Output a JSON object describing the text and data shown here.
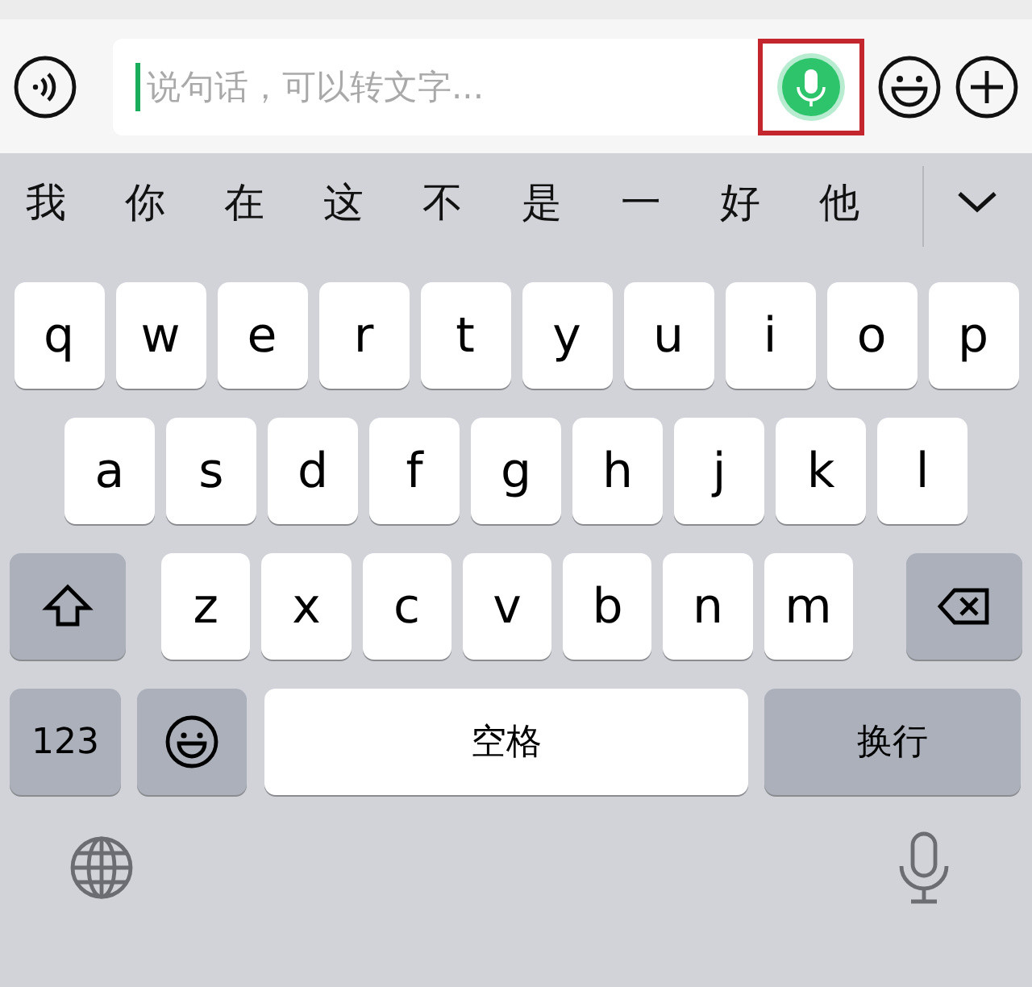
{
  "input_bar": {
    "placeholder": "说句话，可以转文字...",
    "voice_to_text": {
      "highlighted": true
    }
  },
  "candidates": [
    "我",
    "你",
    "在",
    "这",
    "不",
    "是",
    "一",
    "好",
    "他"
  ],
  "keyboard": {
    "rows": [
      {
        "keys": [
          {
            "kind": "letter",
            "label": "q"
          },
          {
            "kind": "letter",
            "label": "w"
          },
          {
            "kind": "letter",
            "label": "e"
          },
          {
            "kind": "letter",
            "label": "r"
          },
          {
            "kind": "letter",
            "label": "t"
          },
          {
            "kind": "letter",
            "label": "y"
          },
          {
            "kind": "letter",
            "label": "u"
          },
          {
            "kind": "letter",
            "label": "i"
          },
          {
            "kind": "letter",
            "label": "o"
          },
          {
            "kind": "letter",
            "label": "p"
          }
        ]
      },
      {
        "keys": [
          {
            "kind": "letter",
            "label": "a"
          },
          {
            "kind": "letter",
            "label": "s"
          },
          {
            "kind": "letter",
            "label": "d"
          },
          {
            "kind": "letter",
            "label": "f"
          },
          {
            "kind": "letter",
            "label": "g"
          },
          {
            "kind": "letter",
            "label": "h"
          },
          {
            "kind": "letter",
            "label": "j"
          },
          {
            "kind": "letter",
            "label": "k"
          },
          {
            "kind": "letter",
            "label": "l"
          }
        ]
      },
      {
        "keys": [
          {
            "kind": "shift"
          },
          {
            "kind": "letter",
            "label": "z"
          },
          {
            "kind": "letter",
            "label": "x"
          },
          {
            "kind": "letter",
            "label": "c"
          },
          {
            "kind": "letter",
            "label": "v"
          },
          {
            "kind": "letter",
            "label": "b"
          },
          {
            "kind": "letter",
            "label": "n"
          },
          {
            "kind": "letter",
            "label": "m"
          },
          {
            "kind": "backspace"
          }
        ]
      },
      {
        "keys": [
          {
            "kind": "numbers",
            "label": "123"
          },
          {
            "kind": "emoji"
          },
          {
            "kind": "space",
            "label": "空格"
          },
          {
            "kind": "return",
            "label": "换行"
          }
        ]
      }
    ]
  }
}
